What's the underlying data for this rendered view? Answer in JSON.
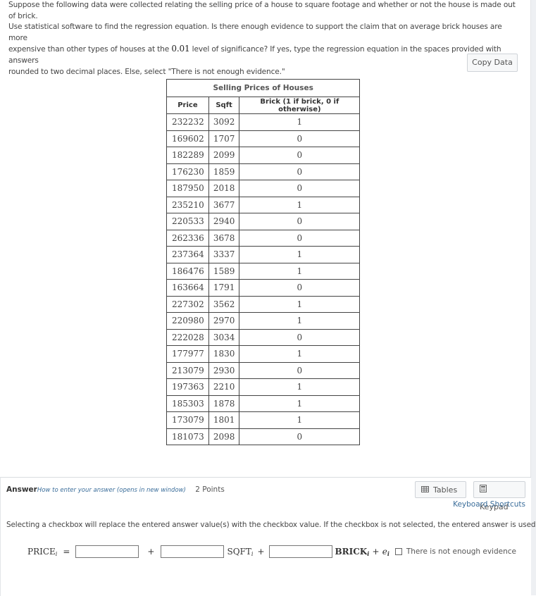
{
  "question": {
    "line1": "Suppose the following data were collected relating the selling price of a house to square footage and whether or not the house is made out of brick.",
    "line2": "Use statistical software to find the regression equation. Is there enough evidence to support the claim that on average brick houses are more",
    "line3_before": "expensive than other types of houses at the ",
    "significance": "0.01",
    "line3_after": " level of significance? If yes, type the regression equation in the spaces provided with answers",
    "line4": "rounded to two decimal places. Else, select \"There is not enough evidence.\""
  },
  "copy_data_label": "Copy Data",
  "table": {
    "caption": "Selling Prices of Houses",
    "headers": [
      "Price",
      "Sqft",
      "Brick (1 if brick, 0 if otherwise)"
    ],
    "rows": [
      [
        "232232",
        "3092",
        "1"
      ],
      [
        "169602",
        "1707",
        "0"
      ],
      [
        "182289",
        "2099",
        "0"
      ],
      [
        "176230",
        "1859",
        "0"
      ],
      [
        "187950",
        "2018",
        "0"
      ],
      [
        "235210",
        "3677",
        "1"
      ],
      [
        "220533",
        "2940",
        "0"
      ],
      [
        "262336",
        "3678",
        "0"
      ],
      [
        "237364",
        "3337",
        "1"
      ],
      [
        "186476",
        "1589",
        "1"
      ],
      [
        "163664",
        "1791",
        "0"
      ],
      [
        "227302",
        "3562",
        "1"
      ],
      [
        "220980",
        "2970",
        "1"
      ],
      [
        "222028",
        "3034",
        "0"
      ],
      [
        "177977",
        "1830",
        "1"
      ],
      [
        "213079",
        "2930",
        "0"
      ],
      [
        "197363",
        "2210",
        "1"
      ],
      [
        "185303",
        "1878",
        "1"
      ],
      [
        "173079",
        "1801",
        "1"
      ],
      [
        "181073",
        "2098",
        "0"
      ]
    ]
  },
  "answer": {
    "title": "Answer",
    "help_link": "How to enter your answer (opens in new window)",
    "points": "2 Points",
    "tables_label": "Tables",
    "keypad_label": "Keypad",
    "keyboard_shortcuts": "Keyboard Shortcuts",
    "instruction": "Selecting a checkbox will replace the entered answer value(s) with the checkbox value. If the checkbox is not selected, the entered answer is used.",
    "equation": {
      "lhs": "PRICE",
      "sub_i": "i",
      "eq": "=",
      "plus": "+",
      "sqft_term": "SQFT",
      "brick_term": "BRICK",
      "error_term": "e",
      "intercept_value": "",
      "sqft_value": "",
      "brick_value": ""
    },
    "checkbox_label": "There is not enough evidence",
    "checkbox_checked": false
  }
}
